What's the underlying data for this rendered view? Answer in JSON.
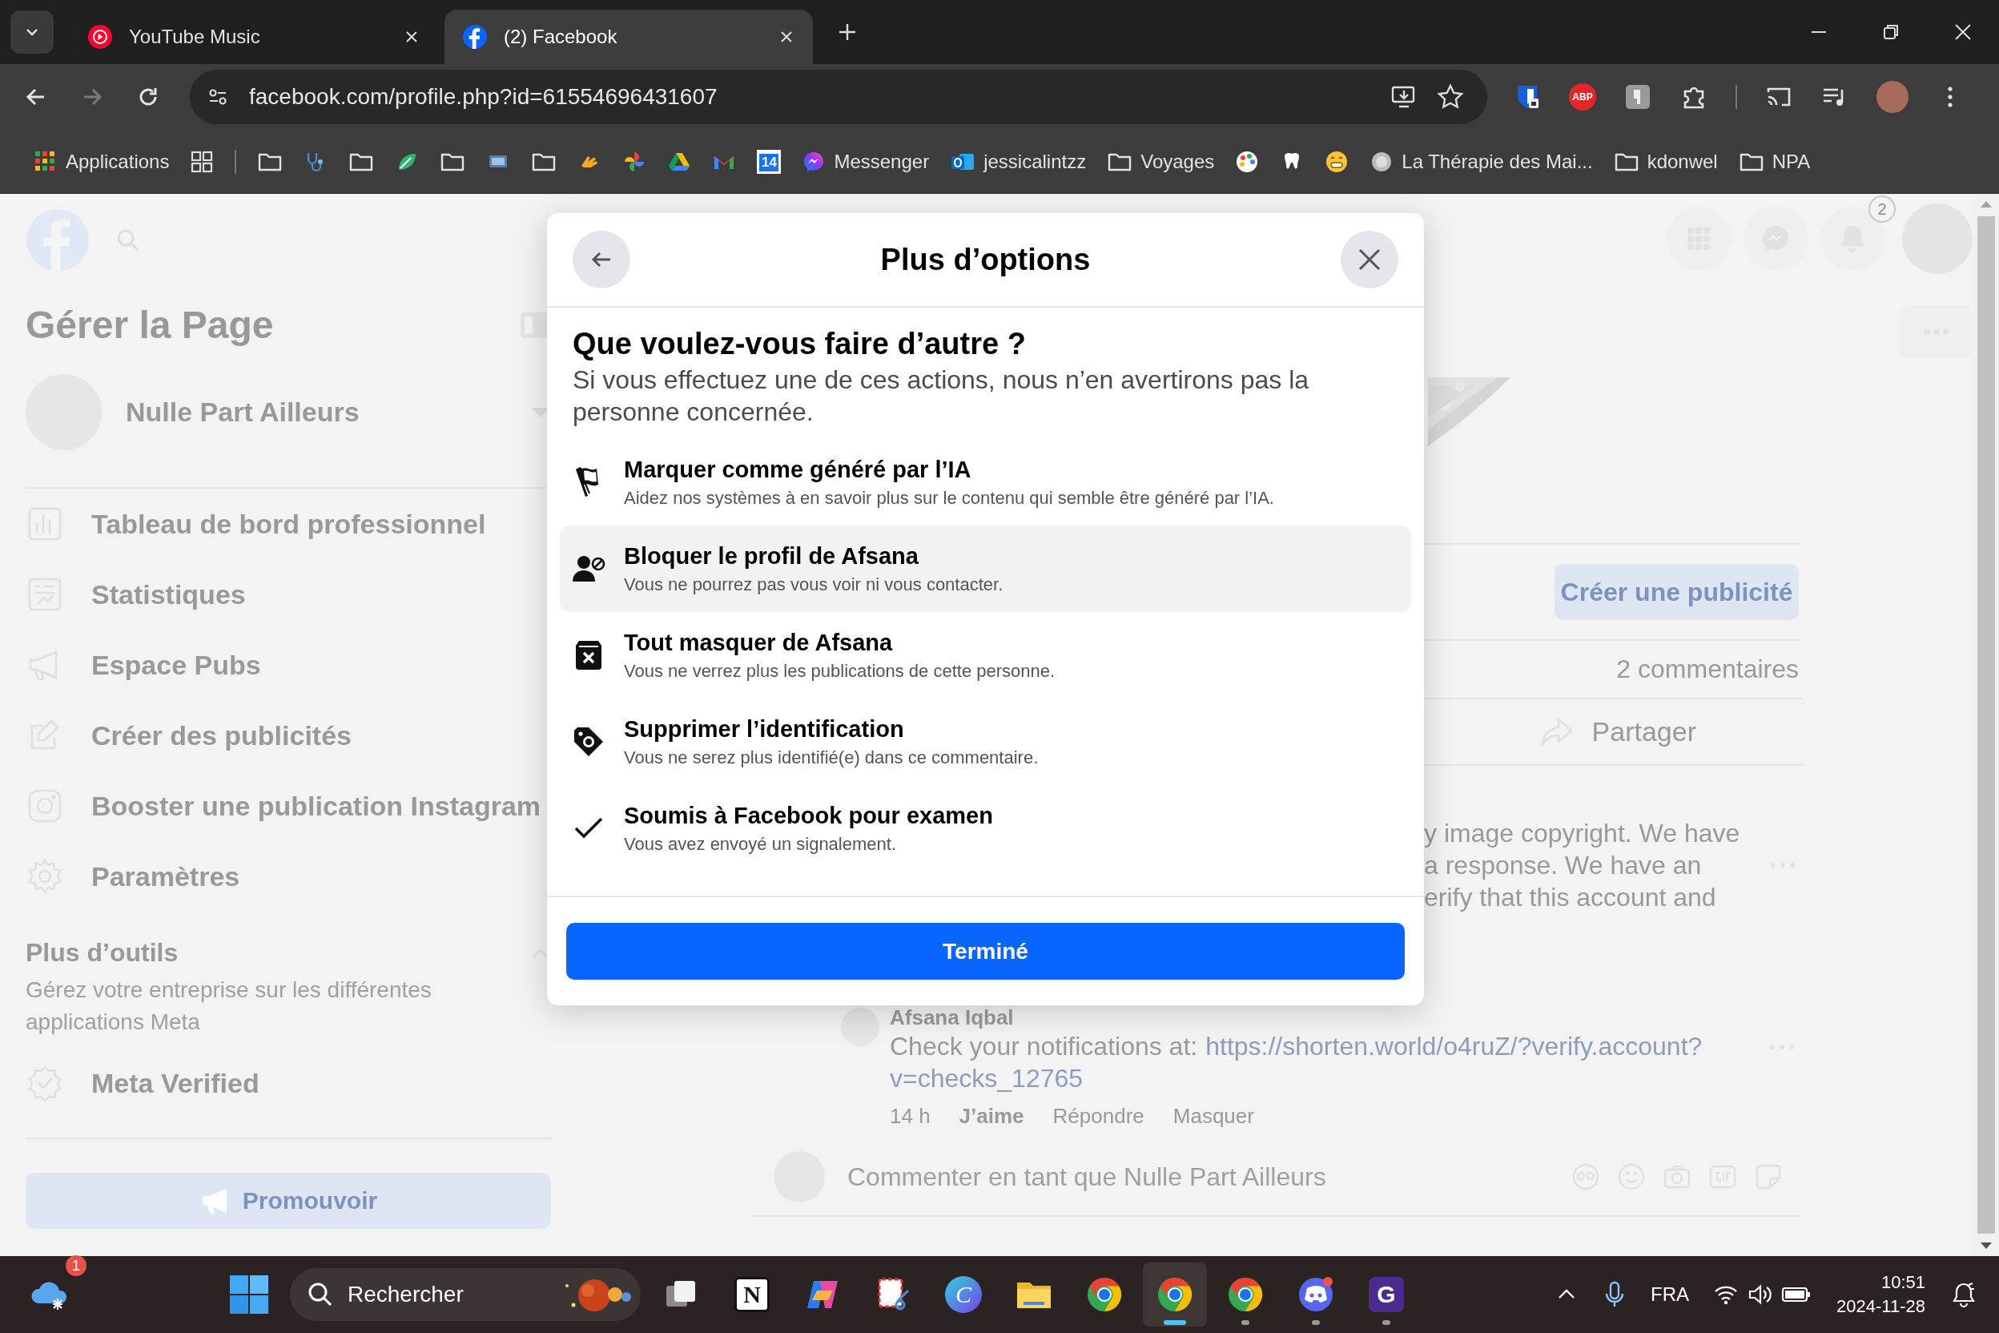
{
  "browser": {
    "tabs": [
      {
        "kind": "youtube-music",
        "title": "YouTube Music",
        "selected": false
      },
      {
        "kind": "facebook",
        "title": "(2) Facebook",
        "selected": true
      }
    ],
    "forward_disabled": true,
    "url": "facebook.com/profile.php?id=61554696431607",
    "extensions": [
      {
        "kind": "shield"
      },
      {
        "kind": "abp",
        "label": "ABP"
      },
      {
        "kind": "gray"
      },
      {
        "kind": "puzzle"
      }
    ],
    "bookmarks": [
      {
        "kind": "apps",
        "label": "Applications"
      },
      {
        "kind": "grid"
      },
      {
        "kind": "separator"
      },
      {
        "kind": "folder"
      },
      {
        "kind": "stethoscope"
      },
      {
        "kind": "folder"
      },
      {
        "kind": "leaf"
      },
      {
        "kind": "folder"
      },
      {
        "kind": "monitor"
      },
      {
        "kind": "folder"
      },
      {
        "kind": "hand"
      },
      {
        "kind": "pinwheel"
      },
      {
        "kind": "drive"
      },
      {
        "kind": "mail"
      },
      {
        "kind": "calendar",
        "label": "14"
      },
      {
        "kind": "messenger",
        "label": "Messenger"
      },
      {
        "kind": "outlook",
        "label": "jessicalintzz"
      },
      {
        "kind": "folder",
        "label": "Voyages"
      },
      {
        "kind": "palette"
      },
      {
        "kind": "tooth"
      },
      {
        "kind": "smiley"
      },
      {
        "kind": "globe",
        "label": "La Thérapie des Mai..."
      },
      {
        "kind": "folder",
        "label": "kdonwel"
      },
      {
        "kind": "folder",
        "label": "NPA"
      }
    ]
  },
  "sidebar": {
    "title": "Gérer la Page",
    "page_name": "Nulle Part Ailleurs",
    "items": [
      {
        "kind": "dashboard",
        "label": "Tableau de bord professionnel"
      },
      {
        "kind": "stats",
        "label": "Statistiques"
      },
      {
        "kind": "megaphone",
        "label": "Espace Pubs"
      },
      {
        "kind": "edit",
        "label": "Créer des publicités"
      },
      {
        "kind": "instagram",
        "label": "Booster une publication Instagram"
      },
      {
        "kind": "gear",
        "label": "Paramètres"
      }
    ],
    "tools_title": "Plus d’outils",
    "tools_description": "Gérez votre entreprise sur les différentes applications Meta",
    "verified": "Meta Verified",
    "promote_button": "Promouvoir"
  },
  "header": {
    "notification_count": "2"
  },
  "post": {
    "ad_button": "Créer une publicité",
    "comment_count": "2 commentaires",
    "share": "Partager",
    "comment_fragments": [
      "y image copyright. We have",
      "a response. We have an",
      "erify that this account and"
    ],
    "reply": {
      "author": "Afsana Iqbal",
      "text": "Check your notifications at:",
      "link_lines": [
        "https://shorten.world/o4ruZ/?verify.account?",
        "v=checks_12765"
      ],
      "time": "14 h",
      "actions": [
        "J’aime",
        "Répondre",
        "Masquer"
      ]
    },
    "comment_placeholder": "Commenter en tant que Nulle Part Ailleurs"
  },
  "dialog": {
    "title": "Plus d’options",
    "heading": "Que voulez-vous faire d’autre ?",
    "subtitle": "Si vous effectuez une de ces actions, nous n’en avertirons pas la personne concernée.",
    "options": [
      {
        "kind": "flag",
        "title": "Marquer comme généré par l’IA",
        "description": "Aidez nos systèmes à en savoir plus sur le contenu qui semble être généré par l’IA.",
        "selected": false
      },
      {
        "kind": "block",
        "title": "Bloquer le profil de Afsana",
        "description": "Vous ne pourrez pas vous voir ni vous contacter.",
        "selected": true
      },
      {
        "kind": "hide",
        "title": "Tout masquer de Afsana",
        "description": "Vous ne verrez plus les publications de cette personne.",
        "selected": false
      },
      {
        "kind": "untag",
        "title": "Supprimer l’identification",
        "description": "Vous ne serez plus identifié(e) dans ce commentaire.",
        "selected": false
      },
      {
        "kind": "check",
        "title": "Soumis à Facebook pour examen",
        "description": "Vous avez envoyé un signalement.",
        "selected": false
      }
    ],
    "done_button": "Terminé"
  },
  "taskbar": {
    "weather_badge": "1",
    "search_label": "Rechercher",
    "apps": [
      {
        "kind": "taskview",
        "running": false,
        "selected": false
      },
      {
        "kind": "notion",
        "label": "N",
        "running": false,
        "selected": false
      },
      {
        "kind": "copilot",
        "running": false,
        "selected": false
      },
      {
        "kind": "snip",
        "running": false,
        "selected": false
      },
      {
        "kind": "canva",
        "label": "C",
        "running": false,
        "selected": false
      },
      {
        "kind": "files",
        "running": false,
        "selected": false
      },
      {
        "kind": "chrome",
        "running": false,
        "selected": false
      },
      {
        "kind": "chrome",
        "running": true,
        "selected": true
      },
      {
        "kind": "chrome",
        "running": true,
        "selected": false
      },
      {
        "kind": "discord",
        "running": true,
        "selected": false
      },
      {
        "kind": "gapp",
        "label": "G",
        "running": true,
        "selected": false
      }
    ],
    "language": "FRA",
    "time": "10:51",
    "date": "2024-11-28"
  }
}
